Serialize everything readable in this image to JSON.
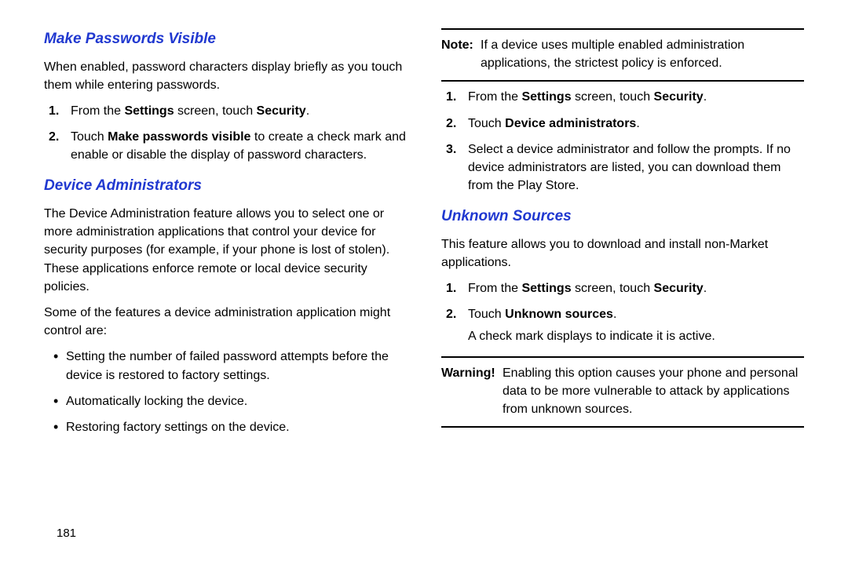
{
  "pageNumber": "181",
  "left": {
    "h1": "Make Passwords Visible",
    "p1": "When enabled, password characters display briefly as you touch them while entering passwords.",
    "step1_pre": "From the ",
    "step1_b1": "Settings",
    "step1_mid": " screen, touch ",
    "step1_b2": "Security",
    "step1_post": ".",
    "step2_pre": "Touch ",
    "step2_b1": "Make passwords visible",
    "step2_post": " to create a check mark and enable or disable the display of password characters.",
    "h2": "Device Administrators",
    "p2": "The Device Administration feature allows you to select one or more administration applications that control your device for security purposes (for example, if your phone is lost of stolen). These applications enforce remote or local device security policies.",
    "p3": "Some of the features a device administration application might control are:",
    "b1": "Setting the number of failed password attempts before the device is restored to factory settings.",
    "b2": "Automatically locking the device.",
    "b3": "Restoring factory settings on the device."
  },
  "right": {
    "note_label": "Note:",
    "note_text": " If a device uses multiple enabled administration applications, the strictest policy is enforced.",
    "step1_pre": "From the ",
    "step1_b1": "Settings",
    "step1_mid": " screen, touch ",
    "step1_b2": "Security",
    "step1_post": ".",
    "step2_pre": "Touch ",
    "step2_b1": "Device administrators",
    "step2_post": ".",
    "step3": "Select a device administrator and follow the prompts. If no device administrators are listed, you can download them from the Play Store.",
    "h1": "Unknown Sources",
    "p1": "This feature allows you to download and install non-Market applications.",
    "us_step1_pre": "From the ",
    "us_step1_b1": "Settings",
    "us_step1_mid": " screen, touch ",
    "us_step1_b2": "Security",
    "us_step1_post": ".",
    "us_step2_pre": "Touch ",
    "us_step2_b1": "Unknown sources",
    "us_step2_post": ".",
    "us_trail": "A check mark displays to indicate it is active.",
    "warn_label": "Warning!",
    "warn_text": " Enabling this option causes your phone and personal data to be more vulnerable to attack by applications from unknown sources."
  }
}
